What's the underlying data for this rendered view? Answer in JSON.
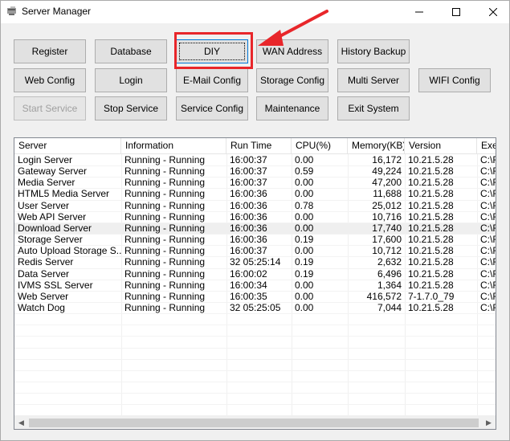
{
  "window": {
    "title": "Server Manager"
  },
  "buttons": {
    "register": "Register",
    "database": "Database",
    "diy": "DIY",
    "wan_address": "WAN Address",
    "history_backup": "History Backup",
    "web_config": "Web Config",
    "login": "Login",
    "email_config": "E-Mail Config",
    "storage_config": "Storage Config",
    "multi_server": "Multi Server",
    "wifi_config": "WIFI Config",
    "start_service": "Start Service",
    "stop_service": "Stop Service",
    "service_config": "Service Config",
    "maintenance": "Maintenance",
    "exit_system": "Exit System"
  },
  "table": {
    "columns": [
      "Server",
      "Information",
      "Run Time",
      "CPU(%)",
      "Memory(KB)",
      "Version",
      "Exe"
    ],
    "rows": [
      [
        "Login Server",
        "Running - Running",
        "16:00:37",
        "0.00",
        "16,172",
        "10.21.5.28",
        "C:\\F"
      ],
      [
        "Gateway Server",
        "Running - Running",
        "16:00:37",
        "0.59",
        "49,224",
        "10.21.5.28",
        "C:\\F"
      ],
      [
        "Media Server",
        "Running - Running",
        "16:00:37",
        "0.00",
        "47,200",
        "10.21.5.28",
        "C:\\F"
      ],
      [
        "HTML5 Media Server",
        "Running - Running",
        "16:00:36",
        "0.00",
        "11,688",
        "10.21.5.28",
        "C:\\F"
      ],
      [
        "User Server",
        "Running - Running",
        "16:00:36",
        "0.78",
        "25,012",
        "10.21.5.28",
        "C:\\F"
      ],
      [
        "Web API Server",
        "Running - Running",
        "16:00:36",
        "0.00",
        "10,716",
        "10.21.5.28",
        "C:\\F"
      ],
      [
        "Download Server",
        "Running - Running",
        "16:00:36",
        "0.00",
        "17,740",
        "10.21.5.28",
        "C:\\F"
      ],
      [
        "Storage Server",
        "Running - Running",
        "16:00:36",
        "0.19",
        "17,600",
        "10.21.5.28",
        "C:\\F"
      ],
      [
        "Auto Upload Storage S...",
        "Running - Running",
        "16:00:37",
        "0.00",
        "10,712",
        "10.21.5.28",
        "C:\\F"
      ],
      [
        "Redis Server",
        "Running - Running",
        "32 05:25:14",
        "0.19",
        "2,632",
        "10.21.5.28",
        "C:\\F"
      ],
      [
        "Data Server",
        "Running - Running",
        "16:00:02",
        "0.19",
        "6,496",
        "10.21.5.28",
        "C:\\F"
      ],
      [
        "IVMS SSL Server",
        "Running - Running",
        "16:00:34",
        "0.00",
        "1,364",
        "10.21.5.28",
        "C:\\F"
      ],
      [
        "Web Server",
        "Running - Running",
        "16:00:35",
        "0.00",
        "416,572",
        "7-1.7.0_79",
        "C:\\F"
      ],
      [
        "Watch Dog",
        "Running - Running",
        "32 05:25:05",
        "0.00",
        "7,044",
        "10.21.5.28",
        "C:\\F"
      ]
    ]
  },
  "colors": {
    "highlight": "#e8262a",
    "focus": "#0078d7"
  },
  "icons": [
    "app-icon",
    "minimize-icon",
    "maximize-icon",
    "close-icon",
    "scroll-left-icon",
    "scroll-right-icon"
  ]
}
